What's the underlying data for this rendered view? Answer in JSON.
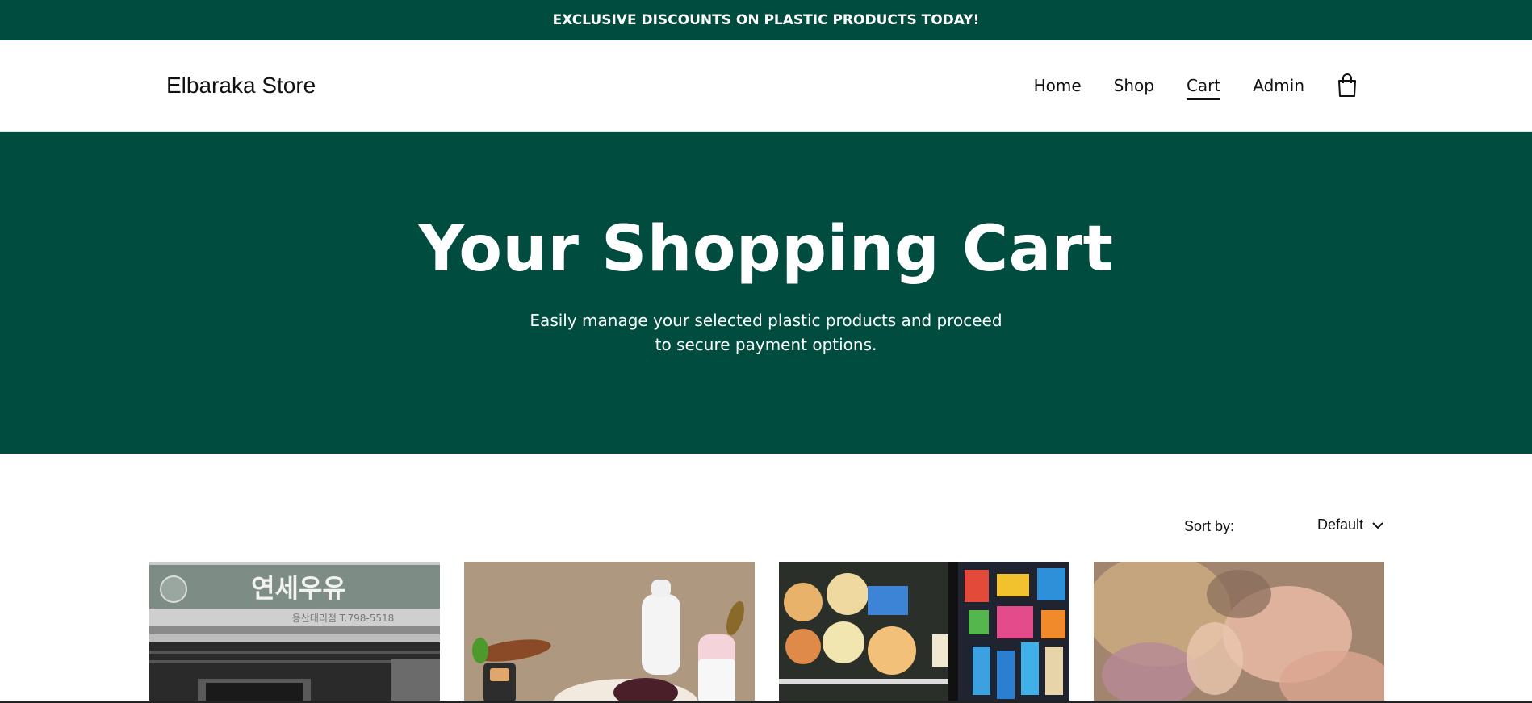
{
  "announcement": {
    "text": "EXCLUSIVE DISCOUNTS ON PLASTIC PRODUCTS TODAY!"
  },
  "header": {
    "logo": "Elbaraka Store",
    "nav": [
      {
        "label": "Home",
        "active": false
      },
      {
        "label": "Shop",
        "active": false
      },
      {
        "label": "Cart",
        "active": true
      },
      {
        "label": "Admin",
        "active": false
      }
    ],
    "cart_icon": "shopping-bag-icon"
  },
  "hero": {
    "title": "Your Shopping Cart",
    "subtitle": "Easily manage your selected plastic products and proceed to secure payment options."
  },
  "sort": {
    "label": "Sort by:",
    "selected": "Default",
    "icon": "chevron-down-icon"
  },
  "products": [
    {
      "image": "korean-milk-shop-sign-photo",
      "sign_text": "연세우유",
      "sign_sub": "용산대리점  T.798-5518"
    },
    {
      "image": "plastic-toy-food-photo"
    },
    {
      "image": "shop-shelf-magnets-photo"
    },
    {
      "image": "plastic-dolls-photo"
    }
  ],
  "colors": {
    "brand_green": "#004c3f",
    "text": "#111111",
    "white": "#ffffff"
  }
}
